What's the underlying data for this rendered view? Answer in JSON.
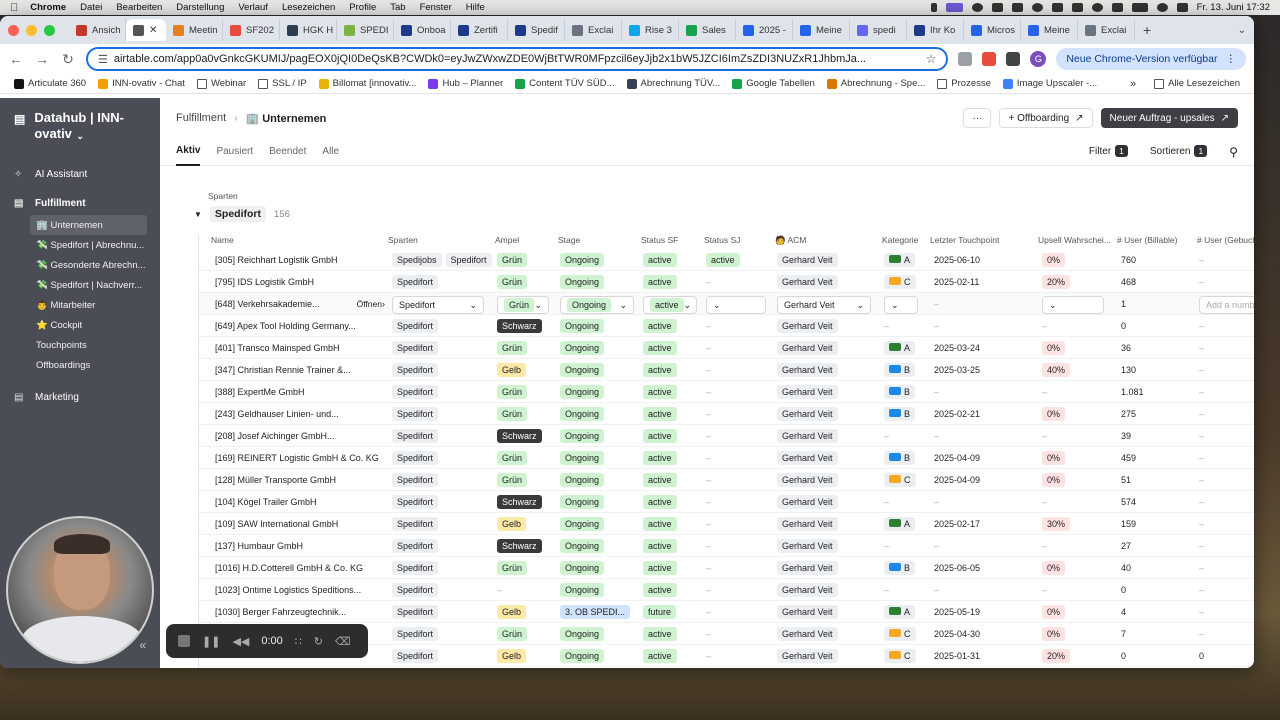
{
  "menubar": {
    "app": "Chrome",
    "items": [
      "Datei",
      "Bearbeiten",
      "Darstellung",
      "Verlauf",
      "Lesezeichen",
      "Profile",
      "Tab",
      "Fenster",
      "Hilfe"
    ],
    "clock": "Fr. 13. Juni 17:32"
  },
  "tabs": [
    {
      "label": "Ansich",
      "color": "#c0392b"
    },
    {
      "label": "",
      "color": "#555555",
      "active": true
    },
    {
      "label": "Meetin",
      "color": "#e67e22"
    },
    {
      "label": "SF202",
      "color": "#e74c3c"
    },
    {
      "label": "HGK H",
      "color": "#2c3e50"
    },
    {
      "label": "SPEDI",
      "color": "#7cb342"
    },
    {
      "label": "Onboa",
      "color": "#1e3a8a"
    },
    {
      "label": "Zertifi",
      "color": "#1e3a8a"
    },
    {
      "label": "Spedif",
      "color": "#1e3a8a"
    },
    {
      "label": "Exclai",
      "color": "#6b7280"
    },
    {
      "label": "Rise 3",
      "color": "#0ea5e9"
    },
    {
      "label": "Sales",
      "color": "#16a34a"
    },
    {
      "label": "2025 -",
      "color": "#2563eb"
    },
    {
      "label": "Meine",
      "color": "#2563eb"
    },
    {
      "label": "spedi",
      "color": "#6366f1"
    },
    {
      "label": "Ihr Ko",
      "color": "#1e3a8a"
    },
    {
      "label": "Micros",
      "color": "#2563eb"
    },
    {
      "label": "Meine",
      "color": "#2563eb"
    },
    {
      "label": "Exclai",
      "color": "#6b7280"
    }
  ],
  "toolbar": {
    "url": "airtable.com/app0a0vGnkcGKUMIJ/pagEOX0jQI0DeQsKB?CWDk0=eyJwZWxwZDE0WjBtTWR0MFpzcil6eyJjb2x1bW5JZCI6ImZsZDI3NUZxR1JhbmJa...",
    "update": "Neue Chrome-Version verfügbar",
    "profile": "G"
  },
  "bookmarks": [
    {
      "label": "Articulate 360",
      "color": "#111111"
    },
    {
      "label": "INN-ovativ - Chat",
      "color": "#f59e0b"
    },
    {
      "label": "Webinar",
      "folder": true
    },
    {
      "label": "SSL / IP",
      "folder": true
    },
    {
      "label": "Billomat [innovativ...",
      "color": "#eab308"
    },
    {
      "label": "Hub – Planner",
      "color": "#7c3aed"
    },
    {
      "label": "Content TÜV SÜD...",
      "color": "#16a34a"
    },
    {
      "label": "Abrechnung TÜV...",
      "color": "#374151"
    },
    {
      "label": "Google Tabellen",
      "color": "#16a34a"
    },
    {
      "label": "Abrechnung - Spe...",
      "color": "#d97706"
    },
    {
      "label": "Prozesse",
      "folder": true
    },
    {
      "label": "Image Upscaler -...",
      "color": "#3b82f6"
    }
  ],
  "bookmarks_all": "Alle Lesezeichen",
  "sidebar": {
    "title": "Datahub | INN-ovativ",
    "ai": "AI Assistant",
    "fulfillment": "Fulfillment",
    "sub": [
      "🏢 Unternemen",
      "💸 Spedifort | Abrechnu...",
      "💸 Gesonderte Abrechn...",
      "💸 Spedifort | Nachverr...",
      "👨 Mitarbeiter",
      "⭐ Cockpit",
      "Touchpoints",
      "Offboardings"
    ],
    "marketing": "Marketing"
  },
  "main": {
    "crumb": "Fulfillment",
    "current": "🏢 Unternemen",
    "dots": "···",
    "offboarding": "+ Offboarding",
    "new_order": "Neuer Auftrag - upsales",
    "views": [
      "Aktiv",
      "Pausiert",
      "Beendet",
      "Alle"
    ],
    "filter": "Filter",
    "filter_count": "1",
    "sort": "Sortieren",
    "sort_count": "1",
    "group_label": "Sparten",
    "group_name": "Spedifort",
    "group_count": "156"
  },
  "columns": [
    "Name",
    "Sparten",
    "Ampel",
    "Stage",
    "Status SF",
    "Status SJ",
    "🧑 ACM",
    "Kategorie",
    "Letzter Touchpoint",
    "Upsell Wahrschei...",
    "# User (Billable)",
    "# User (Gebucht)"
  ],
  "rows": [
    {
      "name": "[305] Reichhart Logistik GmbH",
      "sparten": [
        "Spedijobs",
        "Spedifort"
      ],
      "ampel": "Grün",
      "stage": "Ongoing",
      "sf": "active",
      "sj": "active",
      "acm": "Gerhard Veit",
      "kat": "A",
      "tp": "2025-06-10",
      "upsell": "0%",
      "billable": "760",
      "gebucht": "–"
    },
    {
      "name": "[795] IDS Logistik GmbH",
      "sparten": [
        "Spedifort"
      ],
      "ampel": "Grün",
      "stage": "Ongoing",
      "sf": "active",
      "sj": "–",
      "acm": "Gerhard Veit",
      "kat": "C",
      "tp": "2025-02-11",
      "upsell": "20%",
      "billable": "468",
      "gebucht": "–"
    },
    {
      "name": "[648] Verkehrsakademie...",
      "editing": true,
      "open": "Öffnen",
      "sparten": [
        "Spedifort"
      ],
      "ampel": "Grün",
      "stage": "Ongoing",
      "sf": "active",
      "sj": "",
      "acm": "Gerhard Veit",
      "kat": "",
      "tp": "–",
      "upsell": "",
      "billable": "1",
      "gebucht": "Add a number..."
    },
    {
      "name": "[649] Apex Tool Holding Germany...",
      "sparten": [
        "Spedifort"
      ],
      "ampel": "Schwarz",
      "stage": "Ongoing",
      "sf": "active",
      "sj": "–",
      "acm": "Gerhard Veit",
      "kat": "–",
      "tp": "–",
      "upsell": "–",
      "billable": "0",
      "gebucht": "–"
    },
    {
      "name": "[401] Transco Mainsped GmbH",
      "sparten": [
        "Spedifort"
      ],
      "ampel": "Grün",
      "stage": "Ongoing",
      "sf": "active",
      "sj": "–",
      "acm": "Gerhard Veit",
      "kat": "A",
      "tp": "2025-03-24",
      "upsell": "0%",
      "billable": "36",
      "gebucht": "–"
    },
    {
      "name": "[347] Christian Rennie Trainer &...",
      "sparten": [
        "Spedifort"
      ],
      "ampel": "Gelb",
      "stage": "Ongoing",
      "sf": "active",
      "sj": "–",
      "acm": "Gerhard Veit",
      "kat": "B",
      "tp": "2025-03-25",
      "upsell": "40%",
      "billable": "130",
      "gebucht": "–"
    },
    {
      "name": "[388] ExpertMe GmbH",
      "sparten": [
        "Spedifort"
      ],
      "ampel": "Grün",
      "stage": "Ongoing",
      "sf": "active",
      "sj": "–",
      "acm": "Gerhard Veit",
      "kat": "B",
      "tp": "–",
      "upsell": "–",
      "billable": "1.081",
      "gebucht": "–"
    },
    {
      "name": "[243] Geldhauser Linien- und...",
      "sparten": [
        "Spedifort"
      ],
      "ampel": "Grün",
      "stage": "Ongoing",
      "sf": "active",
      "sj": "–",
      "acm": "Gerhard Veit",
      "kat": "B",
      "tp": "2025-02-21",
      "upsell": "0%",
      "billable": "275",
      "gebucht": "–"
    },
    {
      "name": "[208] Josef Aichinger GmbH...",
      "sparten": [
        "Spedifort"
      ],
      "ampel": "Schwarz",
      "stage": "Ongoing",
      "sf": "active",
      "sj": "–",
      "acm": "Gerhard Veit",
      "kat": "–",
      "tp": "–",
      "upsell": "–",
      "billable": "39",
      "gebucht": "–"
    },
    {
      "name": "[169] REINERT Logistic GmbH & Co. KG",
      "sparten": [
        "Spedifort"
      ],
      "ampel": "Grün",
      "stage": "Ongoing",
      "sf": "active",
      "sj": "–",
      "acm": "Gerhard Veit",
      "kat": "B",
      "tp": "2025-04-09",
      "upsell": "0%",
      "billable": "459",
      "gebucht": "–"
    },
    {
      "name": "[128] Müller Transporte GmbH",
      "sparten": [
        "Spedifort"
      ],
      "ampel": "Grün",
      "stage": "Ongoing",
      "sf": "active",
      "sj": "–",
      "acm": "Gerhard Veit",
      "kat": "C",
      "tp": "2025-04-09",
      "upsell": "0%",
      "billable": "51",
      "gebucht": "–"
    },
    {
      "name": "[104] Kögel Trailer GmbH",
      "sparten": [
        "Spedifort"
      ],
      "ampel": "Schwarz",
      "stage": "Ongoing",
      "sf": "active",
      "sj": "–",
      "acm": "Gerhard Veit",
      "kat": "–",
      "tp": "–",
      "upsell": "–",
      "billable": "574",
      "gebucht": "–"
    },
    {
      "name": "[109] SAW International GmbH",
      "sparten": [
        "Spedifort"
      ],
      "ampel": "Gelb",
      "stage": "Ongoing",
      "sf": "active",
      "sj": "–",
      "acm": "Gerhard Veit",
      "kat": "A",
      "tp": "2025-02-17",
      "upsell": "30%",
      "billable": "159",
      "gebucht": "–"
    },
    {
      "name": "[137] Humbaur GmbH",
      "sparten": [
        "Spedifort"
      ],
      "ampel": "Schwarz",
      "stage": "Ongoing",
      "sf": "active",
      "sj": "–",
      "acm": "Gerhard Veit",
      "kat": "–",
      "tp": "–",
      "upsell": "–",
      "billable": "27",
      "gebucht": "–"
    },
    {
      "name": "[1016] H.D.Cotterell GmbH & Co. KG",
      "sparten": [
        "Spedifort"
      ],
      "ampel": "Grün",
      "stage": "Ongoing",
      "sf": "active",
      "sj": "–",
      "acm": "Gerhard Veit",
      "kat": "B",
      "tp": "2025-06-05",
      "upsell": "0%",
      "billable": "40",
      "gebucht": "–"
    },
    {
      "name": "[1023] Ontime Logistics Speditions...",
      "sparten": [
        "Spedifort"
      ],
      "ampel": "–",
      "stage": "Ongoing",
      "sf": "active",
      "sj": "–",
      "acm": "Gerhard Veit",
      "kat": "–",
      "tp": "–",
      "upsell": "–",
      "billable": "0",
      "gebucht": "–"
    },
    {
      "name": "[1030] Berger Fahrzeugtechnik...",
      "sparten": [
        "Spedifort"
      ],
      "ampel": "Gelb",
      "stage": "3. OB SPEDI...",
      "sf": "future",
      "sj": "–",
      "acm": "Gerhard Veit",
      "kat": "A",
      "tp": "2025-05-19",
      "upsell": "0%",
      "billable": "4",
      "gebucht": "–"
    },
    {
      "name": "",
      "sparten": [
        "Spedifort"
      ],
      "ampel": "Grün",
      "stage": "Ongoing",
      "sf": "active",
      "sj": "–",
      "acm": "Gerhard Veit",
      "kat": "C",
      "tp": "2025-04-30",
      "upsell": "0%",
      "billable": "7",
      "gebucht": "–"
    },
    {
      "name": "",
      "sparten": [
        "Spedifort"
      ],
      "ampel": "Gelb",
      "stage": "Ongoing",
      "sf": "active",
      "sj": "–",
      "acm": "Gerhard Veit",
      "kat": "C",
      "tp": "2025-01-31",
      "upsell": "20%",
      "billable": "0",
      "gebucht": "0"
    }
  ],
  "recorder": {
    "time": "0:00"
  }
}
